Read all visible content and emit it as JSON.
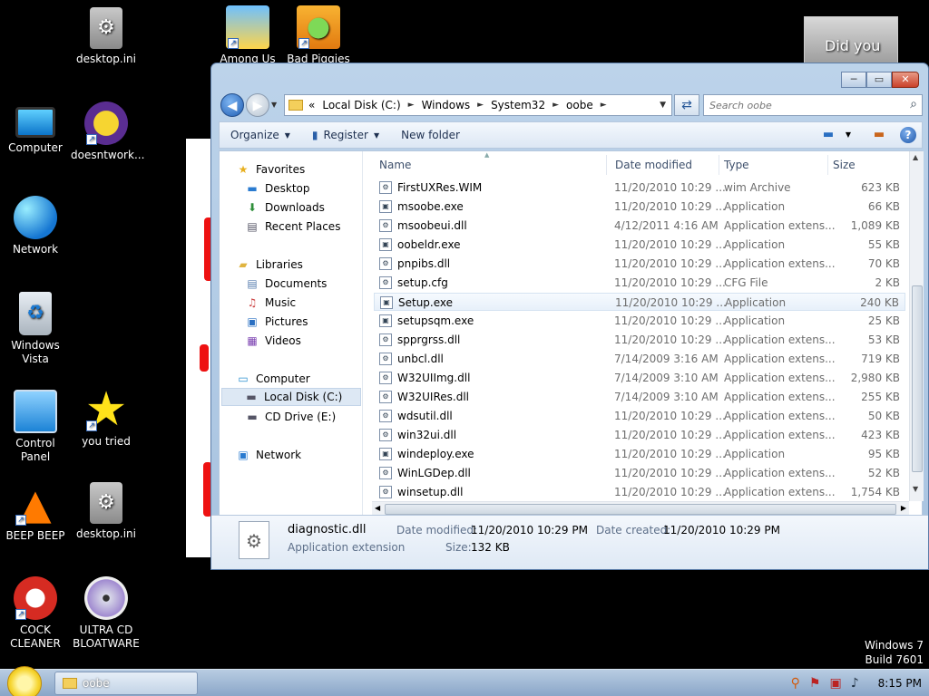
{
  "desktop": {
    "icons": [
      {
        "label": "desktop.ini"
      },
      {
        "label": "Among Us"
      },
      {
        "label": "Bad Piggies"
      },
      {
        "label": "Computer"
      },
      {
        "label": "doesntwork..."
      },
      {
        "label": "Network"
      },
      {
        "label": "Windows Vista"
      },
      {
        "label": "Control Panel"
      },
      {
        "label": "you tried"
      },
      {
        "label": "BEEP BEEP"
      },
      {
        "label": "desktop.ini"
      },
      {
        "label": "COCK CLEANER"
      },
      {
        "label": "ULTRA CD BLOATWARE"
      }
    ],
    "webcam_text": "Did you",
    "watermark": {
      "line1": "Windows 7",
      "line2": "Build 7601"
    }
  },
  "window": {
    "caption": {
      "minimize": "─",
      "maximize": "▭",
      "close": "✕"
    },
    "address": {
      "prefix": "«",
      "crumbs": [
        "Local Disk (C:)",
        "Windows",
        "System32",
        "oobe"
      ],
      "sep": "►",
      "dropdown": "▼"
    },
    "search_placeholder": "Search oobe",
    "toolbar": {
      "organize": "Organize",
      "register": "Register",
      "new_folder": "New folder",
      "dd": "▼"
    },
    "nav": {
      "favorites": "Favorites",
      "desktop": "Desktop",
      "downloads": "Downloads",
      "recent": "Recent Places",
      "libraries": "Libraries",
      "documents": "Documents",
      "music": "Music",
      "pictures": "Pictures",
      "videos": "Videos",
      "computer": "Computer",
      "local_disk": "Local Disk (C:)",
      "cd_drive": "CD Drive (E:)",
      "network": "Network"
    },
    "columns": {
      "name": "Name",
      "date": "Date modified",
      "type": "Type",
      "size": "Size"
    },
    "files": [
      {
        "name": "FirstUXRes.WIM",
        "date": "11/20/2010 10:29 ...",
        "type": "wim Archive",
        "size": "623 KB"
      },
      {
        "name": "msoobe.exe",
        "date": "11/20/2010 10:29 ...",
        "type": "Application",
        "size": "66 KB"
      },
      {
        "name": "msoobeui.dll",
        "date": "4/12/2011 4:16 AM",
        "type": "Application extens...",
        "size": "1,089 KB"
      },
      {
        "name": "oobeldr.exe",
        "date": "11/20/2010 10:29 ...",
        "type": "Application",
        "size": "55 KB"
      },
      {
        "name": "pnpibs.dll",
        "date": "11/20/2010 10:29 ...",
        "type": "Application extens...",
        "size": "70 KB"
      },
      {
        "name": "setup.cfg",
        "date": "11/20/2010 10:29 ...",
        "type": "CFG File",
        "size": "2 KB"
      },
      {
        "name": "Setup.exe",
        "date": "11/20/2010 10:29 ...",
        "type": "Application",
        "size": "240 KB"
      },
      {
        "name": "setupsqm.exe",
        "date": "11/20/2010 10:29 ...",
        "type": "Application",
        "size": "25 KB"
      },
      {
        "name": "spprgrss.dll",
        "date": "11/20/2010 10:29 ...",
        "type": "Application extens...",
        "size": "53 KB"
      },
      {
        "name": "unbcl.dll",
        "date": "7/14/2009 3:16 AM",
        "type": "Application extens...",
        "size": "719 KB"
      },
      {
        "name": "W32UIImg.dll",
        "date": "7/14/2009 3:10 AM",
        "type": "Application extens...",
        "size": "2,980 KB"
      },
      {
        "name": "W32UIRes.dll",
        "date": "7/14/2009 3:10 AM",
        "type": "Application extens...",
        "size": "255 KB"
      },
      {
        "name": "wdsutil.dll",
        "date": "11/20/2010 10:29 ...",
        "type": "Application extens...",
        "size": "50 KB"
      },
      {
        "name": "win32ui.dll",
        "date": "11/20/2010 10:29 ...",
        "type": "Application extens...",
        "size": "423 KB"
      },
      {
        "name": "windeploy.exe",
        "date": "11/20/2010 10:29 ...",
        "type": "Application",
        "size": "95 KB"
      },
      {
        "name": "WinLGDep.dll",
        "date": "11/20/2010 10:29 ...",
        "type": "Application extens...",
        "size": "52 KB"
      },
      {
        "name": "winsetup.dll",
        "date": "11/20/2010 10:29 ...",
        "type": "Application extens...",
        "size": "1,754 KB"
      }
    ],
    "details": {
      "name": "diagnostic.dll",
      "kind": "Application extension",
      "date_modified_label": "Date modified:",
      "date_modified": "11/20/2010 10:29 PM",
      "date_created_label": "Date created:",
      "date_created": "11/20/2010 10:29 PM",
      "size_label": "Size:",
      "size": "132 KB"
    }
  },
  "taskbar": {
    "task_label": "oobe",
    "clock": "8:15 PM"
  }
}
